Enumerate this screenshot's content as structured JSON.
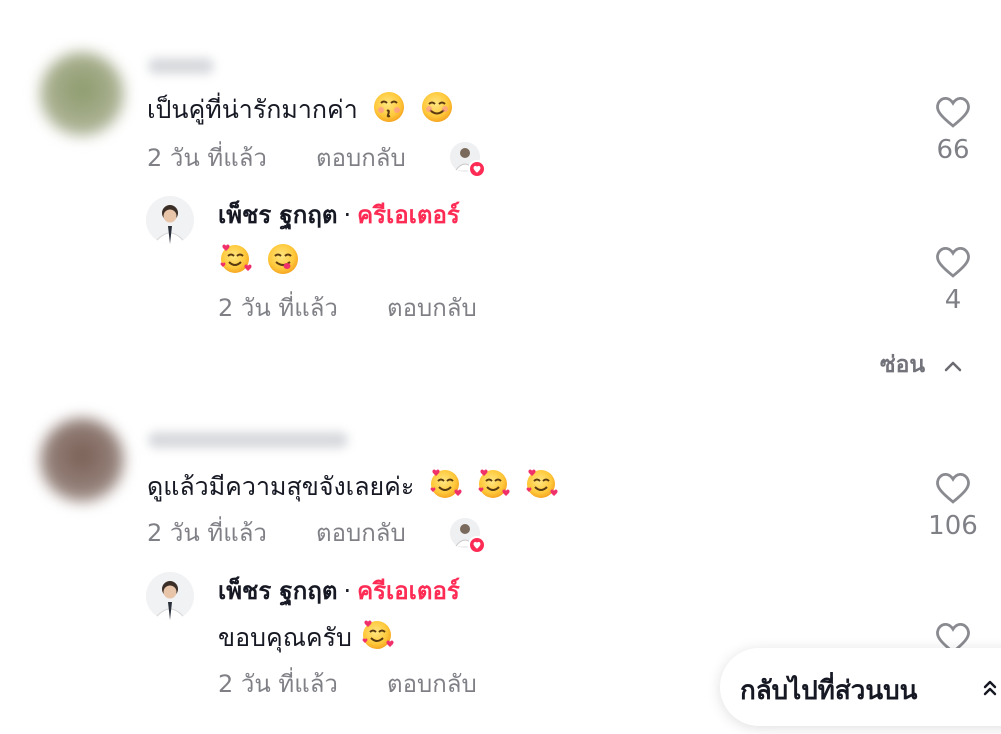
{
  "comments": [
    {
      "text": "เป็นคู่ที่น่ารักมากค่า",
      "time": "2 วัน ที่แล้ว",
      "reply_label": "ตอบกลับ",
      "likes": "66",
      "emojis": [
        "kissing-face",
        "smiling-face"
      ],
      "reply": {
        "author": "เพ็ชร ฐกฤต",
        "separator": "·",
        "badge": "ครีเอเตอร์",
        "text": "",
        "emojis": [
          "smiling-face-with-hearts",
          "face-savoring-food"
        ],
        "time": "2 วัน ที่แล้ว",
        "reply_label": "ตอบกลับ",
        "likes": "4"
      },
      "hide_label": "ซ่อน"
    },
    {
      "text": "ดูแล้วมีความสุขจังเลยค่ะ",
      "time": "2 วัน ที่แล้ว",
      "reply_label": "ตอบกลับ",
      "likes": "106",
      "emojis": [
        "smiling-face-with-hearts",
        "smiling-face-with-hearts",
        "smiling-face-with-hearts"
      ],
      "reply": {
        "author": "เพ็ชร ฐกฤต",
        "separator": "·",
        "badge": "ครีเอเตอร์",
        "text": "ขอบคุณครับ",
        "emojis": [
          "smiling-face-with-hearts"
        ],
        "time": "2 วัน ที่แล้ว",
        "reply_label": "ตอบกลับ"
      }
    }
  ],
  "back_to_top": "กลับไปที่ส่วนบน",
  "colors": {
    "accent": "#fe2c55",
    "text": "#161823",
    "muted": "#8a8b91"
  }
}
